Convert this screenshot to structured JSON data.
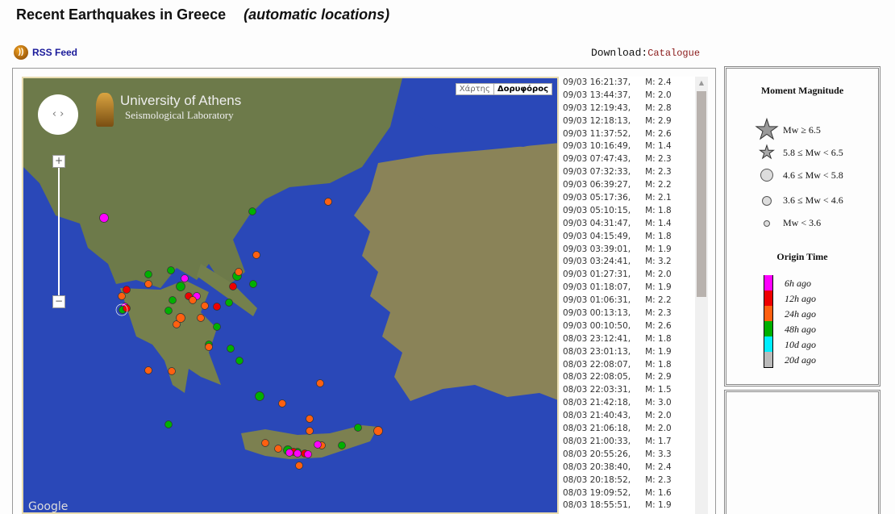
{
  "header": {
    "title": "Recent Earthquakes in Greece",
    "subtitle": "automatic locations",
    "rss_label": "RSS Feed",
    "download_label": "Download:",
    "catalogue_link": "Catalogue"
  },
  "map": {
    "brand_line1": "University of Athens",
    "brand_line2": "Seismological Laboratory",
    "map_type_map": "Χάρτης",
    "map_type_satellite": "Δορυφόρος",
    "zoom_in": "+",
    "zoom_out": "−",
    "attribution": "Google"
  },
  "events": [
    {
      "time": "09/03 16:21:37,",
      "mag": "M: 2.4"
    },
    {
      "time": "09/03 13:44:37,",
      "mag": "M: 2.0"
    },
    {
      "time": "09/03 12:19:43,",
      "mag": "M: 2.8"
    },
    {
      "time": "09/03 12:18:13,",
      "mag": "M: 2.9"
    },
    {
      "time": "09/03 11:37:52,",
      "mag": "M: 2.6"
    },
    {
      "time": "09/03 10:16:49,",
      "mag": "M: 1.4"
    },
    {
      "time": "09/03 07:47:43,",
      "mag": "M: 2.3"
    },
    {
      "time": "09/03 07:32:33,",
      "mag": "M: 2.3"
    },
    {
      "time": "09/03 06:39:27,",
      "mag": "M: 2.2"
    },
    {
      "time": "09/03 05:17:36,",
      "mag": "M: 2.1"
    },
    {
      "time": "09/03 05:10:15,",
      "mag": "M: 1.8"
    },
    {
      "time": "09/03 04:31:47,",
      "mag": "M: 1.4"
    },
    {
      "time": "09/03 04:15:49,",
      "mag": "M: 1.8"
    },
    {
      "time": "09/03 03:39:01,",
      "mag": "M: 1.9"
    },
    {
      "time": "09/03 03:24:41,",
      "mag": "M: 3.2"
    },
    {
      "time": "09/03 01:27:31,",
      "mag": "M: 2.0"
    },
    {
      "time": "09/03 01:18:07,",
      "mag": "M: 1.9"
    },
    {
      "time": "09/03 01:06:31,",
      "mag": "M: 2.2"
    },
    {
      "time": "09/03 00:13:13,",
      "mag": "M: 2.3"
    },
    {
      "time": "09/03 00:10:50,",
      "mag": "M: 2.6"
    },
    {
      "time": "08/03 23:12:41,",
      "mag": "M: 1.8"
    },
    {
      "time": "08/03 23:01:13,",
      "mag": "M: 1.9"
    },
    {
      "time": "08/03 22:08:07,",
      "mag": "M: 1.8"
    },
    {
      "time": "08/03 22:08:05,",
      "mag": "M: 2.9"
    },
    {
      "time": "08/03 22:03:31,",
      "mag": "M: 1.5"
    },
    {
      "time": "08/03 21:42:18,",
      "mag": "M: 3.0"
    },
    {
      "time": "08/03 21:40:43,",
      "mag": "M: 2.0"
    },
    {
      "time": "08/03 21:06:18,",
      "mag": "M: 2.0"
    },
    {
      "time": "08/03 21:00:33,",
      "mag": "M: 1.7"
    },
    {
      "time": "08/03 20:55:26,",
      "mag": "M: 3.3"
    },
    {
      "time": "08/03 20:38:40,",
      "mag": "M: 2.4"
    },
    {
      "time": "08/03 20:18:52,",
      "mag": "M: 2.3"
    },
    {
      "time": "08/03 19:09:52,",
      "mag": "M: 1.6"
    },
    {
      "time": "08/03 18:55:51,",
      "mag": "M: 1.9"
    }
  ],
  "legend": {
    "magnitude_title": "Moment Magnitude",
    "magnitude_classes": [
      "Mw ≥ 6.5",
      "5.8 ≤ Mw < 6.5",
      "4.6 ≤ Mw < 5.8",
      "3.6 ≤ Mw < 4.6",
      "Mw < 3.6"
    ],
    "time_title": "Origin Time",
    "time_classes": [
      {
        "label": "6h ago",
        "color": "#ff00ff"
      },
      {
        "label": "12h ago",
        "color": "#ee0000"
      },
      {
        "label": "24h ago",
        "color": "#ff6010"
      },
      {
        "label": "48h ago",
        "color": "#00b000"
      },
      {
        "label": "10d ago",
        "color": "#00eeff"
      },
      {
        "label": "20d ago",
        "color": "#bbbbbb"
      }
    ]
  }
}
